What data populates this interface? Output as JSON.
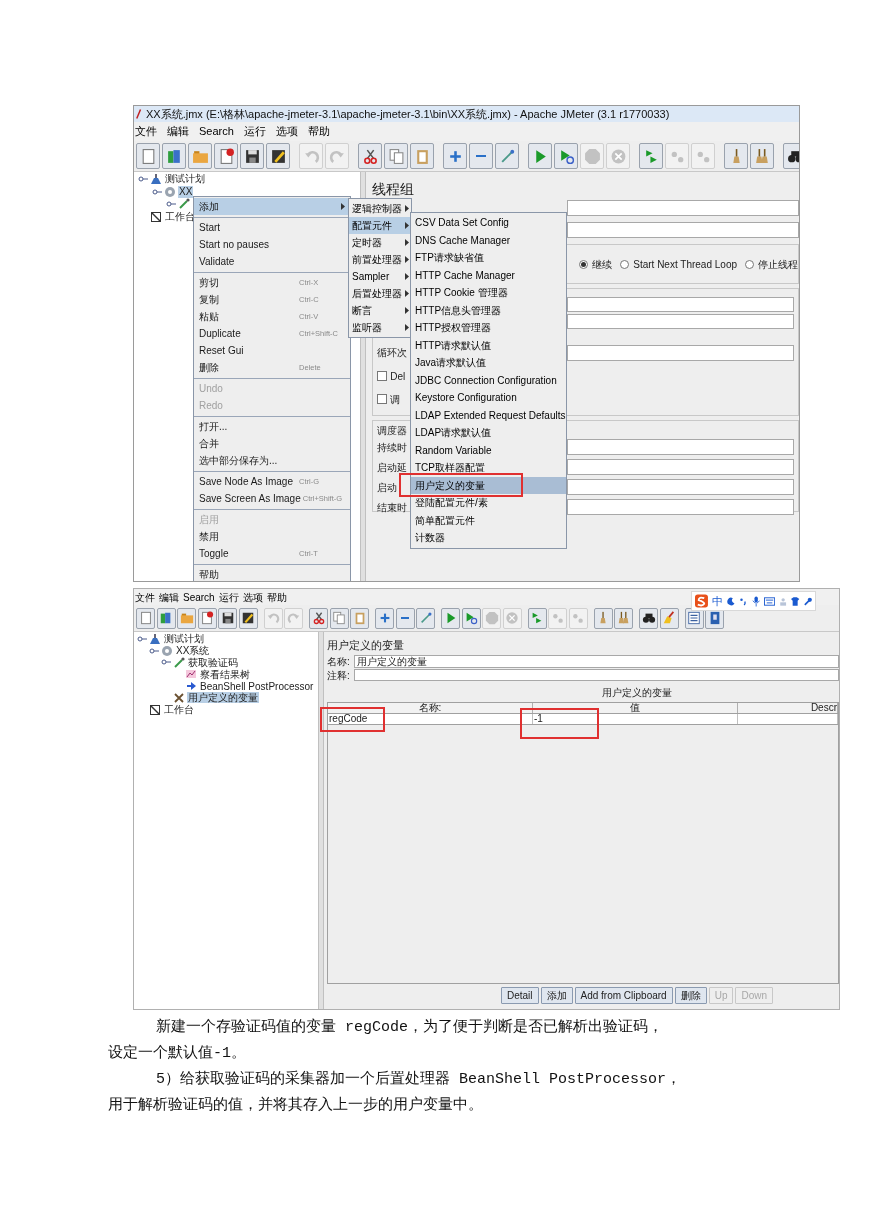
{
  "screenshot_1": {
    "window_title": "XX系统.jmx (E:\\格林\\apache-jmeter-3.1\\apache-jmeter-3.1\\bin\\XX系统.jmx) - Apache JMeter (3.1 r1770033)",
    "menu_bar": [
      "文件",
      "编辑",
      "Search",
      "运行",
      "选项",
      "帮助"
    ],
    "toolbar": [
      [
        {
          "kind": "new",
          "disabled": false
        },
        {
          "kind": "templates",
          "disabled": false
        },
        {
          "kind": "open",
          "disabled": false
        },
        {
          "kind": "close",
          "disabled": false
        },
        {
          "kind": "save",
          "disabled": false
        },
        {
          "kind": "save_as",
          "disabled": false
        }
      ],
      [
        {
          "kind": "undo",
          "disabled": true
        },
        {
          "kind": "redo",
          "disabled": true
        }
      ],
      [
        {
          "kind": "cut",
          "disabled": false
        },
        {
          "kind": "copy",
          "disabled": false
        },
        {
          "kind": "paste",
          "disabled": false
        }
      ],
      [
        {
          "kind": "expand",
          "disabled": false
        },
        {
          "kind": "collapse",
          "disabled": false
        },
        {
          "kind": "toggle",
          "disabled": false
        }
      ],
      [
        {
          "kind": "start",
          "disabled": false
        },
        {
          "kind": "start_no_pause",
          "disabled": false
        },
        {
          "kind": "stop",
          "disabled": true
        },
        {
          "kind": "shutdown",
          "disabled": true
        }
      ],
      [
        {
          "kind": "remote_start",
          "disabled": false
        },
        {
          "kind": "remote_stop",
          "disabled": true
        },
        {
          "kind": "remote_exit",
          "disabled": true
        }
      ],
      [
        {
          "kind": "clear",
          "disabled": false
        },
        {
          "kind": "clear_all",
          "disabled": false
        }
      ],
      [
        {
          "kind": "search",
          "disabled": false
        }
      ]
    ],
    "tree": [
      {
        "label": "测试计划",
        "kind": "test_plan",
        "selected": false,
        "expanded": true,
        "children": [
          {
            "label": "XX",
            "kind": "thread_group",
            "selected": true,
            "expanded": true,
            "children": [
              {
                "kind": "sampler",
                "expanded": true
              }
            ]
          }
        ]
      },
      {
        "label": "工作台",
        "kind": "workbench",
        "selected": false
      }
    ],
    "panel": {
      "title": "线程组",
      "error_actions": [
        {
          "label": "继续",
          "selected": true
        },
        {
          "label": "Start Next Thread Loop",
          "selected": false
        },
        {
          "label": "停止线程",
          "selected": false
        }
      ],
      "loop_label": "循环次",
      "checkboxes": [
        {
          "label": "Del",
          "checked": false
        },
        {
          "label": "调",
          "checked": false
        }
      ],
      "scheduler_title": "调度器",
      "scheduler_fields": [
        "持续时",
        "启动延",
        "启动",
        "结束时"
      ]
    },
    "context_menu": [
      [
        {
          "label": "添加",
          "submenu": true,
          "selected": true,
          "disabled": false
        }
      ],
      [
        {
          "label": "Start",
          "selected": false,
          "disabled": false
        },
        {
          "label": "Start no pauses",
          "selected": false,
          "disabled": false
        },
        {
          "label": "Validate",
          "selected": false,
          "disabled": false
        }
      ],
      [
        {
          "label": "剪切",
          "shortcut": "Ctrl-X",
          "selected": false,
          "disabled": false
        },
        {
          "label": "复制",
          "shortcut": "Ctrl-C",
          "selected": false,
          "disabled": false
        },
        {
          "label": "粘贴",
          "shortcut": "Ctrl-V",
          "selected": false,
          "disabled": false
        },
        {
          "label": "Duplicate",
          "shortcut": "Ctrl+Shift-C",
          "selected": false,
          "disabled": false
        },
        {
          "label": "Reset Gui",
          "selected": false,
          "disabled": false
        },
        {
          "label": "删除",
          "shortcut": "Delete",
          "selected": false,
          "disabled": false
        }
      ],
      [
        {
          "label": "Undo",
          "selected": false,
          "disabled": true
        },
        {
          "label": "Redo",
          "selected": false,
          "disabled": true
        }
      ],
      [
        {
          "label": "打开...",
          "selected": false,
          "disabled": false
        },
        {
          "label": "合并",
          "selected": false,
          "disabled": false
        },
        {
          "label": "选中部分保存为...",
          "selected": false,
          "disabled": false
        }
      ],
      [
        {
          "label": "Save Node As Image",
          "shortcut": "Ctrl-G",
          "selected": false,
          "disabled": false
        },
        {
          "label": "Save Screen As Image",
          "shortcut": "Ctrl+Shift-G",
          "selected": false,
          "disabled": false
        }
      ],
      [
        {
          "label": "启用",
          "selected": false,
          "disabled": true
        },
        {
          "label": "禁用",
          "selected": false,
          "disabled": false
        },
        {
          "label": "Toggle",
          "shortcut": "Ctrl-T",
          "selected": false,
          "disabled": false
        }
      ],
      [
        {
          "label": "帮助",
          "selected": false,
          "disabled": false
        }
      ]
    ],
    "add_submenu": [
      {
        "label": "逻辑控制器",
        "selected": false
      },
      {
        "label": "配置元件",
        "selected": true
      },
      {
        "label": "定时器",
        "selected": false
      },
      {
        "label": "前置处理器",
        "selected": false
      },
      {
        "label": "Sampler",
        "selected": false
      },
      {
        "label": "后置处理器",
        "selected": false
      },
      {
        "label": "断言",
        "selected": false
      },
      {
        "label": "监听器",
        "selected": false
      }
    ],
    "config_submenu": [
      {
        "label": "CSV Data Set Config",
        "selected": false
      },
      {
        "label": "DNS Cache Manager",
        "selected": false
      },
      {
        "label": "FTP请求缺省值",
        "selected": false
      },
      {
        "label": "HTTP Cache Manager",
        "selected": false
      },
      {
        "label": "HTTP Cookie 管理器",
        "selected": false
      },
      {
        "label": "HTTP信息头管理器",
        "selected": false
      },
      {
        "label": "HTTP授权管理器",
        "selected": false
      },
      {
        "label": "HTTP请求默认值",
        "selected": false
      },
      {
        "label": "Java请求默认值",
        "selected": false
      },
      {
        "label": "JDBC Connection Configuration",
        "selected": false
      },
      {
        "label": "Keystore Configuration",
        "selected": false
      },
      {
        "label": "LDAP Extended Request Defaults",
        "selected": false
      },
      {
        "label": "LDAP请求默认值",
        "selected": false
      },
      {
        "label": "Random Variable",
        "selected": false
      },
      {
        "label": "TCP取样器配置",
        "selected": false
      },
      {
        "label": "用户定义的变量",
        "selected": true
      },
      {
        "label": "登陆配置元件/素",
        "selected": false
      },
      {
        "label": "简单配置元件",
        "selected": false
      },
      {
        "label": "计数器",
        "selected": false
      }
    ]
  },
  "screenshot_2": {
    "menu_bar": [
      "文件",
      "编辑",
      "Search",
      "运行",
      "选项",
      "帮助"
    ],
    "ime_bar": {
      "label": "中"
    },
    "toolbar": [
      [
        {
          "kind": "new",
          "disabled": false
        },
        {
          "kind": "templates",
          "disabled": false
        },
        {
          "kind": "open",
          "disabled": false
        },
        {
          "kind": "close",
          "disabled": false
        },
        {
          "kind": "save",
          "disabled": false
        },
        {
          "kind": "save_as",
          "disabled": false
        }
      ],
      [
        {
          "kind": "undo",
          "disabled": true
        },
        {
          "kind": "redo",
          "disabled": true
        }
      ],
      [
        {
          "kind": "cut",
          "disabled": false
        },
        {
          "kind": "copy",
          "disabled": false
        },
        {
          "kind": "paste",
          "disabled": false
        }
      ],
      [
        {
          "kind": "expand",
          "disabled": false
        },
        {
          "kind": "collapse",
          "disabled": false
        },
        {
          "kind": "toggle",
          "disabled": false
        }
      ],
      [
        {
          "kind": "start",
          "disabled": false
        },
        {
          "kind": "start_no_pause",
          "disabled": false
        },
        {
          "kind": "stop",
          "disabled": true
        },
        {
          "kind": "shutdown",
          "disabled": true
        }
      ],
      [
        {
          "kind": "remote_start",
          "disabled": false
        },
        {
          "kind": "remote_stop",
          "disabled": true
        },
        {
          "kind": "remote_exit",
          "disabled": true
        }
      ],
      [
        {
          "kind": "clear",
          "disabled": false
        },
        {
          "kind": "clear_all",
          "disabled": false
        }
      ],
      [
        {
          "kind": "search",
          "disabled": false
        },
        {
          "kind": "reset_search",
          "disabled": false
        }
      ],
      [
        {
          "kind": "function_helper",
          "disabled": false
        },
        {
          "kind": "help",
          "disabled": false
        }
      ]
    ],
    "tree": [
      {
        "label": "测试计划",
        "kind": "test_plan",
        "selected": false,
        "expanded": true,
        "children": [
          {
            "label": "XX系统",
            "kind": "thread_group",
            "selected": false,
            "expanded": true,
            "children": [
              {
                "label": "获取验证码",
                "kind": "sampler",
                "selected": false,
                "expanded": true,
                "children": [
                  {
                    "label": "察看结果树",
                    "kind": "listener",
                    "selected": false
                  },
                  {
                    "label": "BeanShell PostProcessor",
                    "kind": "post_processor",
                    "selected": false
                  }
                ]
              },
              {
                "label": "用户定义的变量",
                "kind": "config",
                "selected": true
              }
            ]
          }
        ]
      },
      {
        "label": "工作台",
        "kind": "workbench",
        "selected": false
      }
    ],
    "panel": {
      "title": "用户定义的变量",
      "name_label": "名称:",
      "name_value": "用户定义的变量",
      "comment_label": "注释:",
      "table_title": "用户定义的变量",
      "table": {
        "columns": [
          "名称:",
          "值",
          "Descr"
        ],
        "rows": [
          [
            "regCode",
            "-1",
            ""
          ]
        ]
      },
      "buttons": [
        {
          "label": "Detail",
          "disabled": false
        },
        {
          "label": "添加",
          "disabled": false
        },
        {
          "label": "Add from Clipboard",
          "disabled": false
        },
        {
          "label": "删除",
          "disabled": false
        },
        {
          "label": "Up",
          "disabled": true
        },
        {
          "label": "Down",
          "disabled": true
        }
      ]
    }
  },
  "body_text": [
    {
      "lines": [
        "新建一个存验证码值的变量 regCode，为了便于判断是否已解析出验证码，",
        "设定一个默认值-1。"
      ]
    },
    {
      "lines": [
        "5）给获取验证码的采集器加一个后置处理器 BeanShell PostProcessor，",
        "用于解析验证码的值，并将其存入上一步的用户变量中。"
      ]
    }
  ]
}
